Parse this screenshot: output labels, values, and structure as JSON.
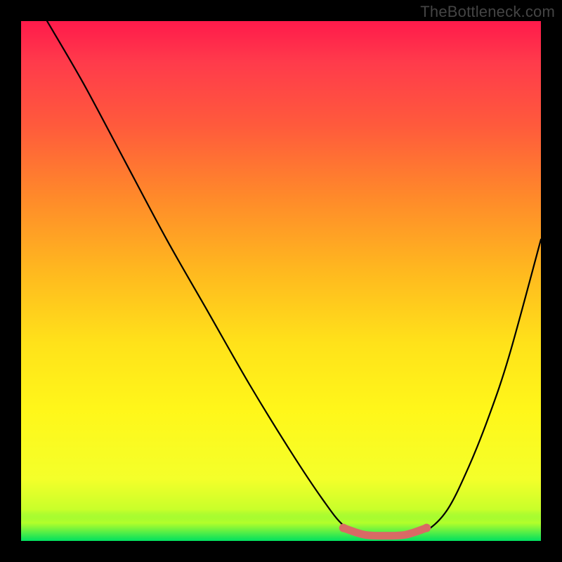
{
  "watermark": "TheBottleneck.com",
  "chart_data": {
    "type": "line",
    "title": "",
    "xlabel": "",
    "ylabel": "",
    "xlim": [
      0,
      100
    ],
    "ylim": [
      0,
      100
    ],
    "grid": false,
    "legend": false,
    "series": [
      {
        "name": "curve",
        "color": "#000000",
        "x": [
          5,
          12,
          20,
          28,
          36,
          44,
          52,
          58,
          62,
          66,
          70,
          74,
          78,
          82,
          86,
          90,
          94,
          100
        ],
        "values": [
          100,
          88,
          73,
          58,
          44,
          30,
          17,
          8,
          3,
          1,
          1,
          1,
          2,
          6,
          14,
          24,
          36,
          58
        ]
      },
      {
        "name": "optimal-band",
        "color": "#d96a65",
        "x": [
          62,
          66,
          70,
          74,
          78
        ],
        "values": [
          2.5,
          1.2,
          1.0,
          1.2,
          2.5
        ]
      }
    ],
    "background_gradient": {
      "direction": "vertical",
      "stops": [
        {
          "pos": 0.0,
          "color": "#ff1a4b"
        },
        {
          "pos": 0.2,
          "color": "#ff5a3c"
        },
        {
          "pos": 0.48,
          "color": "#ffb81f"
        },
        {
          "pos": 0.75,
          "color": "#fff71a"
        },
        {
          "pos": 0.94,
          "color": "#c8ff2a"
        },
        {
          "pos": 1.0,
          "color": "#00e060"
        }
      ]
    }
  }
}
